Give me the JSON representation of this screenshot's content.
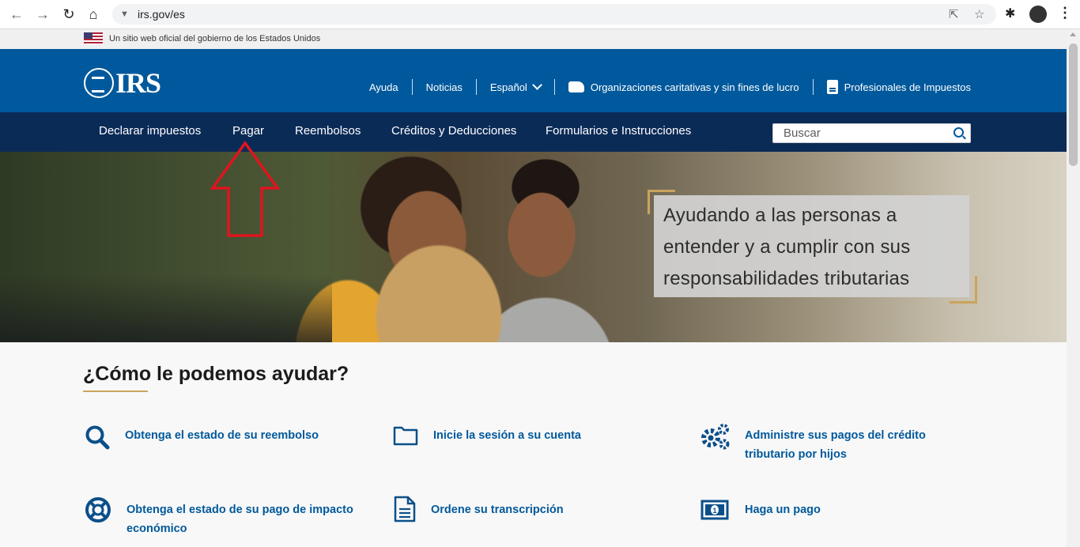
{
  "browser": {
    "url": "irs.gov/es",
    "icons": [
      "back-arrow-icon",
      "forward-arrow-icon",
      "reload-icon",
      "home-icon",
      "site-info-icon",
      "share-icon",
      "star-icon",
      "extensions-icon",
      "profile-avatar",
      "menu-icon"
    ]
  },
  "gov_banner": {
    "text": "Un sitio web oficial del gobierno de los Estados Unidos"
  },
  "header": {
    "logo": "IRS",
    "links": {
      "ayuda": "Ayuda",
      "noticias": "Noticias",
      "espanol": "Español",
      "caridad": "Organizaciones caritativas y sin fines de lucro",
      "profesionales": "Profesionales de Impuestos"
    }
  },
  "mainnav": {
    "items": [
      "Declarar impuestos",
      "Pagar",
      "Reembolsos",
      "Créditos y Deducciones",
      "Formularios e Instrucciones"
    ],
    "search_placeholder": "Buscar"
  },
  "hero": {
    "text": "Ayudando a las personas a entender y a cumplir con sus responsabilidades tributarias"
  },
  "help": {
    "title": "¿Cómo le podemos ayudar?",
    "tiles": [
      {
        "label": "Obtenga el estado de su reembolso",
        "icon": "search-icon"
      },
      {
        "label": "Inicie la sesión a su cuenta",
        "icon": "folder-icon"
      },
      {
        "label": "Administre sus pagos del crédito tributario por hijos",
        "icon": "gears-icon"
      },
      {
        "label": "Obtenga el estado de su pago de impacto económico",
        "icon": "life-ring-icon"
      },
      {
        "label": "Ordene su transcripción",
        "icon": "document-icon"
      },
      {
        "label": "Haga un pago",
        "icon": "money-icon"
      }
    ]
  },
  "colors": {
    "header_blue": "#00599c",
    "nav_navy": "#0b2b57",
    "accent_gold": "#c9a45c",
    "annotation_red": "#e0141e"
  }
}
